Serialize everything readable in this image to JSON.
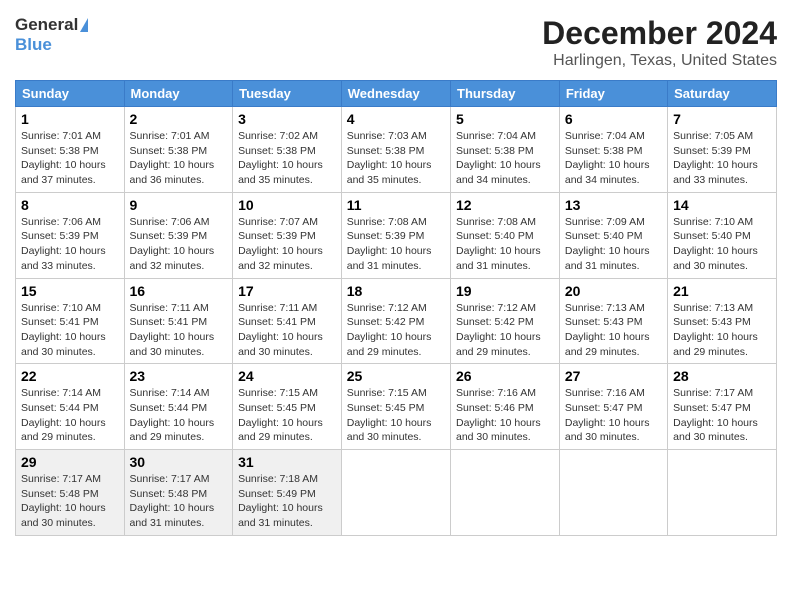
{
  "header": {
    "logo_general": "General",
    "logo_blue": "Blue",
    "month_title": "December 2024",
    "location": "Harlingen, Texas, United States"
  },
  "calendar": {
    "days_of_week": [
      "Sunday",
      "Monday",
      "Tuesday",
      "Wednesday",
      "Thursday",
      "Friday",
      "Saturday"
    ],
    "weeks": [
      [
        null,
        {
          "day": "2",
          "sunrise": "7:01 AM",
          "sunset": "5:38 PM",
          "daylight": "10 hours and 36 minutes."
        },
        {
          "day": "3",
          "sunrise": "7:02 AM",
          "sunset": "5:38 PM",
          "daylight": "10 hours and 35 minutes."
        },
        {
          "day": "4",
          "sunrise": "7:03 AM",
          "sunset": "5:38 PM",
          "daylight": "10 hours and 35 minutes."
        },
        {
          "day": "5",
          "sunrise": "7:04 AM",
          "sunset": "5:38 PM",
          "daylight": "10 hours and 34 minutes."
        },
        {
          "day": "6",
          "sunrise": "7:04 AM",
          "sunset": "5:38 PM",
          "daylight": "10 hours and 34 minutes."
        },
        {
          "day": "7",
          "sunrise": "7:05 AM",
          "sunset": "5:39 PM",
          "daylight": "10 hours and 33 minutes."
        }
      ],
      [
        {
          "day": "1",
          "sunrise": "7:01 AM",
          "sunset": "5:38 PM",
          "daylight": "10 hours and 37 minutes."
        },
        {
          "day": "8",
          "sunrise": "7:06 AM",
          "sunset": "5:39 PM",
          "daylight": "10 hours and 33 minutes."
        },
        {
          "day": "9",
          "sunrise": "7:06 AM",
          "sunset": "5:39 PM",
          "daylight": "10 hours and 32 minutes."
        },
        {
          "day": "10",
          "sunrise": "7:07 AM",
          "sunset": "5:39 PM",
          "daylight": "10 hours and 32 minutes."
        },
        {
          "day": "11",
          "sunrise": "7:08 AM",
          "sunset": "5:39 PM",
          "daylight": "10 hours and 31 minutes."
        },
        {
          "day": "12",
          "sunrise": "7:08 AM",
          "sunset": "5:40 PM",
          "daylight": "10 hours and 31 minutes."
        },
        {
          "day": "13",
          "sunrise": "7:09 AM",
          "sunset": "5:40 PM",
          "daylight": "10 hours and 31 minutes."
        }
      ],
      [
        {
          "day": "14",
          "sunrise": "7:10 AM",
          "sunset": "5:40 PM",
          "daylight": "10 hours and 30 minutes."
        },
        {
          "day": "15",
          "sunrise": "7:10 AM",
          "sunset": "5:41 PM",
          "daylight": "10 hours and 30 minutes."
        },
        {
          "day": "16",
          "sunrise": "7:11 AM",
          "sunset": "5:41 PM",
          "daylight": "10 hours and 30 minutes."
        },
        {
          "day": "17",
          "sunrise": "7:11 AM",
          "sunset": "5:41 PM",
          "daylight": "10 hours and 30 minutes."
        },
        {
          "day": "18",
          "sunrise": "7:12 AM",
          "sunset": "5:42 PM",
          "daylight": "10 hours and 29 minutes."
        },
        {
          "day": "19",
          "sunrise": "7:12 AM",
          "sunset": "5:42 PM",
          "daylight": "10 hours and 29 minutes."
        },
        {
          "day": "20",
          "sunrise": "7:13 AM",
          "sunset": "5:43 PM",
          "daylight": "10 hours and 29 minutes."
        }
      ],
      [
        {
          "day": "21",
          "sunrise": "7:13 AM",
          "sunset": "5:43 PM",
          "daylight": "10 hours and 29 minutes."
        },
        {
          "day": "22",
          "sunrise": "7:14 AM",
          "sunset": "5:44 PM",
          "daylight": "10 hours and 29 minutes."
        },
        {
          "day": "23",
          "sunrise": "7:14 AM",
          "sunset": "5:44 PM",
          "daylight": "10 hours and 29 minutes."
        },
        {
          "day": "24",
          "sunrise": "7:15 AM",
          "sunset": "5:45 PM",
          "daylight": "10 hours and 29 minutes."
        },
        {
          "day": "25",
          "sunrise": "7:15 AM",
          "sunset": "5:45 PM",
          "daylight": "10 hours and 30 minutes."
        },
        {
          "day": "26",
          "sunrise": "7:16 AM",
          "sunset": "5:46 PM",
          "daylight": "10 hours and 30 minutes."
        },
        {
          "day": "27",
          "sunrise": "7:16 AM",
          "sunset": "5:47 PM",
          "daylight": "10 hours and 30 minutes."
        }
      ],
      [
        {
          "day": "28",
          "sunrise": "7:17 AM",
          "sunset": "5:47 PM",
          "daylight": "10 hours and 30 minutes."
        },
        {
          "day": "29",
          "sunrise": "7:17 AM",
          "sunset": "5:48 PM",
          "daylight": "10 hours and 30 minutes."
        },
        {
          "day": "30",
          "sunrise": "7:17 AM",
          "sunset": "5:48 PM",
          "daylight": "10 hours and 31 minutes."
        },
        {
          "day": "31",
          "sunrise": "7:18 AM",
          "sunset": "5:49 PM",
          "daylight": "10 hours and 31 minutes."
        },
        null,
        null,
        null
      ]
    ]
  }
}
